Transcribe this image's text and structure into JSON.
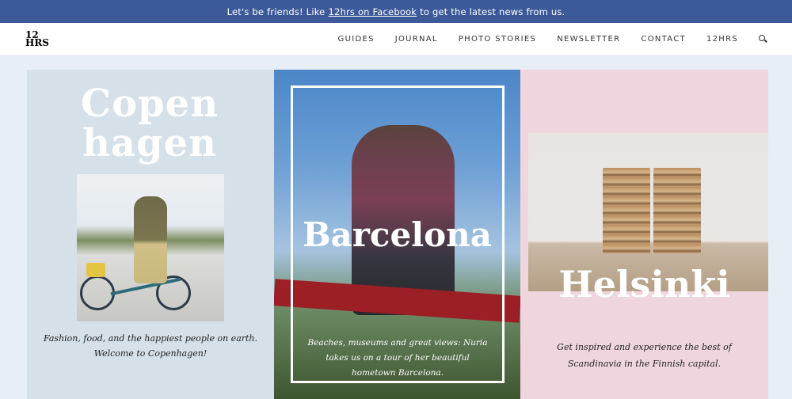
{
  "promo": {
    "before": "Let's be friends! Like",
    "link": "12hrs on Facebook",
    "after": "to get the latest news from us."
  },
  "logo": {
    "line1": "12",
    "line2": "HRS"
  },
  "nav": {
    "items": [
      "GUIDES",
      "JOURNAL",
      "PHOTO STORIES",
      "NEWSLETTER",
      "CONTACT",
      "12HRS"
    ]
  },
  "cards": [
    {
      "title_line1": "Copen",
      "title_line2": "hagen",
      "text": "Fashion, food, and the happiest people on earth. Welcome to Copenhagen!"
    },
    {
      "title": "Barcelona",
      "text": "Beaches, museums and great views: Nuria takes us on a tour of her beautiful hometown Barcelona."
    },
    {
      "title": "Helsinki",
      "text": "Get inspired and experience the best of Scandinavia in the Finnish capital."
    }
  ],
  "colors": {
    "promo_bg": "#3c5a99",
    "copenhagen_bg": "#d6e0e8",
    "helsinki_bg": "#efd6de"
  }
}
